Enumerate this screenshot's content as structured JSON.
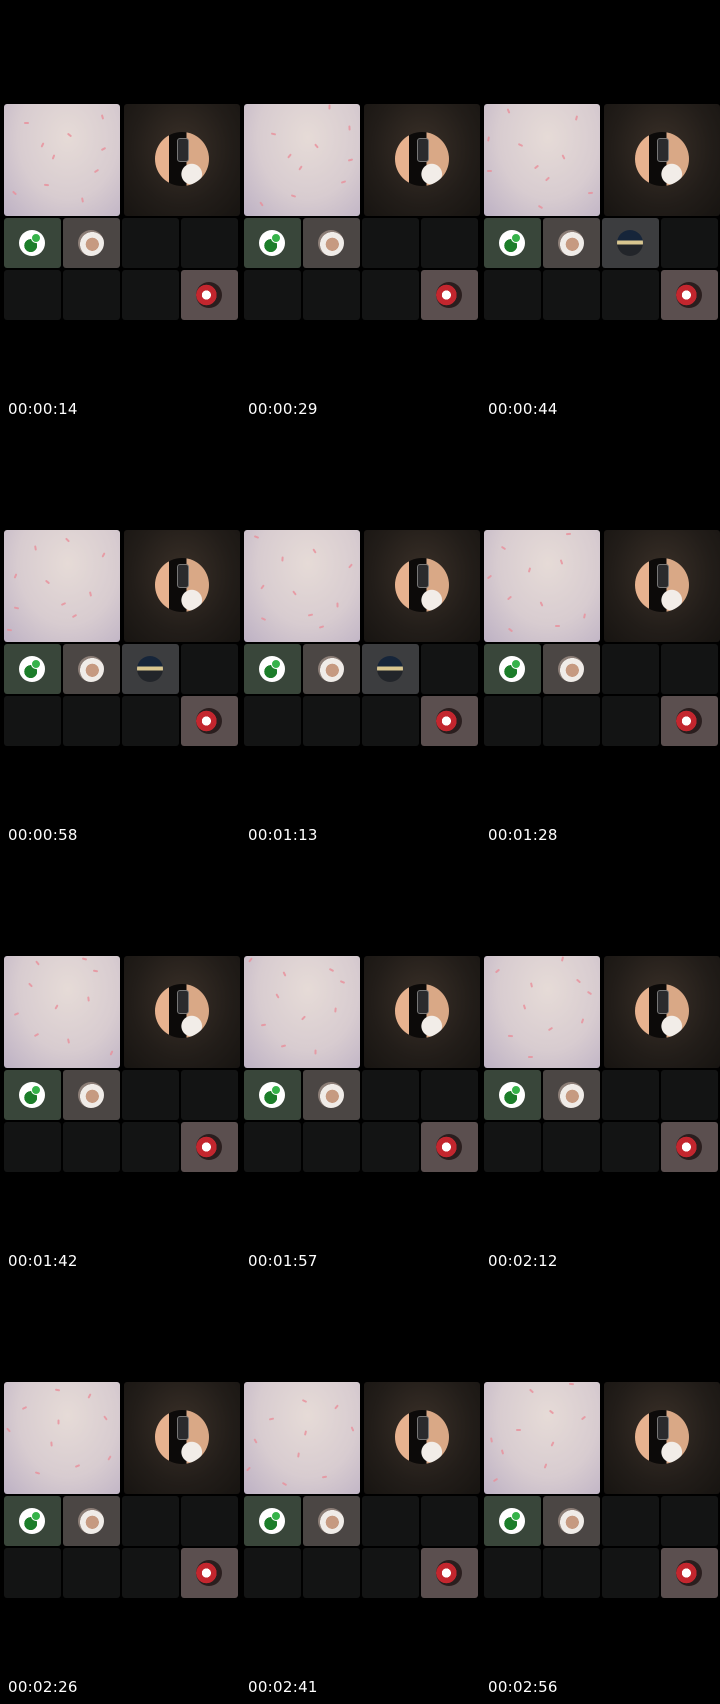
{
  "thumbnails": [
    {
      "timestamp": "00:00:14",
      "extra_avatar": false
    },
    {
      "timestamp": "00:00:29",
      "extra_avatar": false
    },
    {
      "timestamp": "00:00:44",
      "extra_avatar": true
    },
    {
      "timestamp": "00:00:58",
      "extra_avatar": true
    },
    {
      "timestamp": "00:01:13",
      "extra_avatar": true
    },
    {
      "timestamp": "00:01:28",
      "extra_avatar": false
    },
    {
      "timestamp": "00:01:42",
      "extra_avatar": false
    },
    {
      "timestamp": "00:01:57",
      "extra_avatar": false
    },
    {
      "timestamp": "00:02:12",
      "extra_avatar": false
    },
    {
      "timestamp": "00:02:26",
      "extra_avatar": false
    },
    {
      "timestamp": "00:02:41",
      "extra_avatar": false
    },
    {
      "timestamp": "00:02:56",
      "extra_avatar": false
    }
  ],
  "colors": {
    "background": "#000000",
    "empty_tile": "#131414",
    "petal": "#e88f9a"
  },
  "icons": [
    "green-avatar-icon",
    "man-avatar-icon",
    "car-avatar-icon",
    "red-avatar-icon",
    "phone-icon"
  ]
}
